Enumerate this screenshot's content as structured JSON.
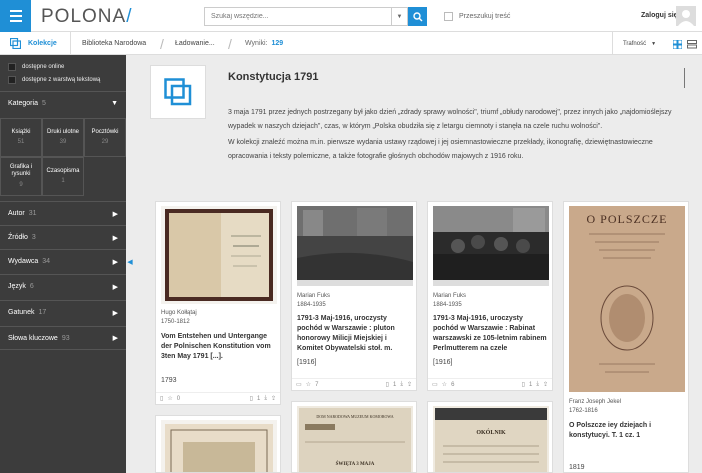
{
  "header": {
    "logo": "POLONA",
    "logo_slash": "/",
    "search_placeholder": "Szukaj wszędzie...",
    "fulltext_label": "Przeszukuj treść",
    "login_label": "Zaloguj się"
  },
  "subbar": {
    "collections_label": "Kolekcje",
    "breadcrumb_1": "Biblioteka Narodowa",
    "breadcrumb_2": "Ładowanie...",
    "results_label": "Wyniki:",
    "results_count": "129",
    "sort_label": "Trafność"
  },
  "sidebar": {
    "filters": [
      {
        "label": "dostępne online"
      },
      {
        "label": "dostępne z warstwą tekstową"
      }
    ],
    "category": {
      "label": "Kategoria",
      "count": "5"
    },
    "categories": [
      {
        "label": "Książki",
        "count": "51"
      },
      {
        "label": "Druki ulotne",
        "count": "39"
      },
      {
        "label": "Pocztówki",
        "count": "29"
      },
      {
        "label": "Grafika i rysunki",
        "count": "9"
      },
      {
        "label": "Czasopisma",
        "count": "1"
      }
    ],
    "sections": [
      {
        "label": "Autor",
        "count": "31"
      },
      {
        "label": "Źródło",
        "count": "3"
      },
      {
        "label": "Wydawca",
        "count": "34"
      },
      {
        "label": "Język",
        "count": "6"
      },
      {
        "label": "Gatunek",
        "count": "17"
      },
      {
        "label": "Słowa kluczowe",
        "count": "93"
      }
    ]
  },
  "collection": {
    "title": "Konstytucja 1791",
    "desc_1": "3 maja 1791 przez jednych postrzegany był jako dzień „zdrady sprawy wolności\", triumf „obłudy narodowej\", przez innych jako „najdomioślejszy wypadek w naszych dziejach\", czas, w którym „Polska obudziła się z letargu ciemnoty i stanęła na czele ruchu wolności\".",
    "desc_2": "W kolekcji znaleźć można m.in. pierwsze wydania ustawy rządowej i jej osiemnastowieczne przekłady, ikonografię, dziewiętnastowieczne opracowania i teksty polemiczne, a także fotografie głośnych obchodów majowych z 1916 roku."
  },
  "cards": [
    {
      "author": "Hugo Kołłątaj",
      "dates": "1750-1812",
      "title": "Vom Entstehen und Untergange der Polnischen Konstitution vom 3ten May 1791 [...].",
      "year": "1793",
      "stars": "0",
      "pages": "1"
    },
    {
      "author": "Marian Fuks",
      "dates": "1884-1935",
      "title": "1791-3 Maj-1916, uroczysty pochód w Warszawie : pluton honorowy Milicji Miejskiej i Komitet Obywatelski stoł. m.",
      "year": "[1916]",
      "stars": "7",
      "pages": "1"
    },
    {
      "author": "Marian Fuks",
      "dates": "1884-1935",
      "title": "1791-3 Maj-1916, uroczysty pochód w Warszawie : Rabinat warszawski ze 105-letnim rabinem Perlmutterem na czele",
      "year": "[1916]",
      "stars": "6",
      "pages": "1"
    },
    {
      "author": "Franz Joseph Jekel",
      "dates": "1762-1816",
      "title": "O Polszcze iey dziejach i konstytucyi. T. 1 cz. 1",
      "year": "1819",
      "stars": "",
      "pages": ""
    }
  ],
  "thumb_texts": {
    "card2b_header": "DOM NARODOWA MUZEUM KOMOROWA",
    "card2b_word": "ŚWIĘTA 3 MAJA",
    "card3b_word": "OKÓLNIK",
    "card4_title": "O POLSZCZE"
  },
  "colors": {
    "accent": "#1f8fd6",
    "sidebar": "#3c3c3c"
  }
}
